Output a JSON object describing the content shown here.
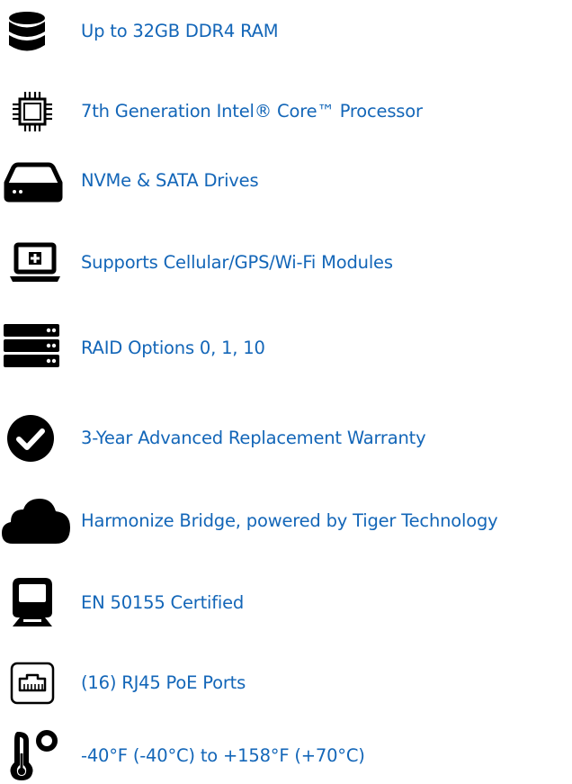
{
  "features": [
    {
      "icon": "database-icon",
      "label": "Up to 32GB DDR4 RAM"
    },
    {
      "icon": "cpu-chip-icon",
      "label": "7th Generation Intel® Core™ Processor"
    },
    {
      "icon": "hard-drive-icon",
      "label": "NVMe & SATA Drives"
    },
    {
      "icon": "laptop-plus-icon",
      "label": "Supports Cellular/GPS/Wi-Fi Modules"
    },
    {
      "icon": "server-rack-icon",
      "label": "RAID Options 0, 1, 10"
    },
    {
      "icon": "check-circle-icon",
      "label": "3-Year Advanced Replacement Warranty"
    },
    {
      "icon": "cloud-icon",
      "label": "Harmonize Bridge, powered by Tiger Technology"
    },
    {
      "icon": "train-icon",
      "label": "EN 50155 Certified"
    },
    {
      "icon": "ethernet-port-icon",
      "label": "(16) RJ45 PoE Ports"
    },
    {
      "icon": "thermometer-icon",
      "label": "-40°F (-40°C) to +158°F (+70°C)"
    }
  ],
  "colors": {
    "text": "#1366b8",
    "icon": "#000000",
    "background": "#ffffff"
  }
}
